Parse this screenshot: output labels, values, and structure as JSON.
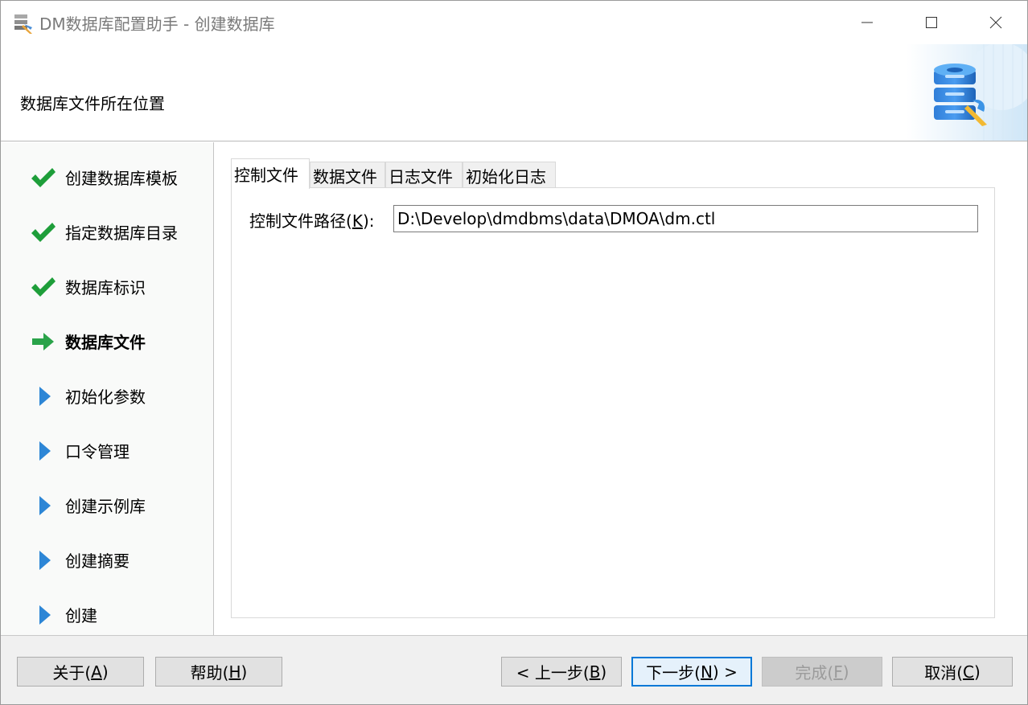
{
  "window": {
    "title": "DM数据库配置助手 - 创建数据库"
  },
  "header": {
    "title": "数据库文件所在位置"
  },
  "steps": [
    {
      "label": "创建数据库模板",
      "status": "done"
    },
    {
      "label": "指定数据库目录",
      "status": "done"
    },
    {
      "label": "数据库标识",
      "status": "done"
    },
    {
      "label": "数据库文件",
      "status": "current"
    },
    {
      "label": "初始化参数",
      "status": "pending"
    },
    {
      "label": "口令管理",
      "status": "pending"
    },
    {
      "label": "创建示例库",
      "status": "pending"
    },
    {
      "label": "创建摘要",
      "status": "pending"
    },
    {
      "label": "创建",
      "status": "pending"
    }
  ],
  "tabs": [
    {
      "label": "控制文件",
      "active": true
    },
    {
      "label": "数据文件",
      "active": false
    },
    {
      "label": "日志文件",
      "active": false
    },
    {
      "label": "初始化日志",
      "active": false
    }
  ],
  "control_file": {
    "label_prefix": "控制文件路径(",
    "label_key": "K",
    "label_suffix": "):",
    "path": "D:\\Develop\\dmdbms\\data\\DMOA\\dm.ctl"
  },
  "buttons": {
    "about": {
      "prefix": "关于(",
      "key": "A",
      "suffix": ")"
    },
    "help": {
      "prefix": "帮助(",
      "key": "H",
      "suffix": ")"
    },
    "prev": {
      "prefix": "< 上一步(",
      "key": "B",
      "suffix": ")"
    },
    "next": {
      "prefix": "下一步(",
      "key": "N",
      "suffix": ") >"
    },
    "finish": {
      "prefix": "完成(",
      "key": "F",
      "suffix": ")"
    },
    "cancel": {
      "prefix": "取消(",
      "key": "C",
      "suffix": ")"
    }
  },
  "colors": {
    "check": "#1e9e3a",
    "arrow_current": "#2aa34a",
    "arrow_pending": "#2d86d6",
    "default_button_border": "#0078d7"
  }
}
